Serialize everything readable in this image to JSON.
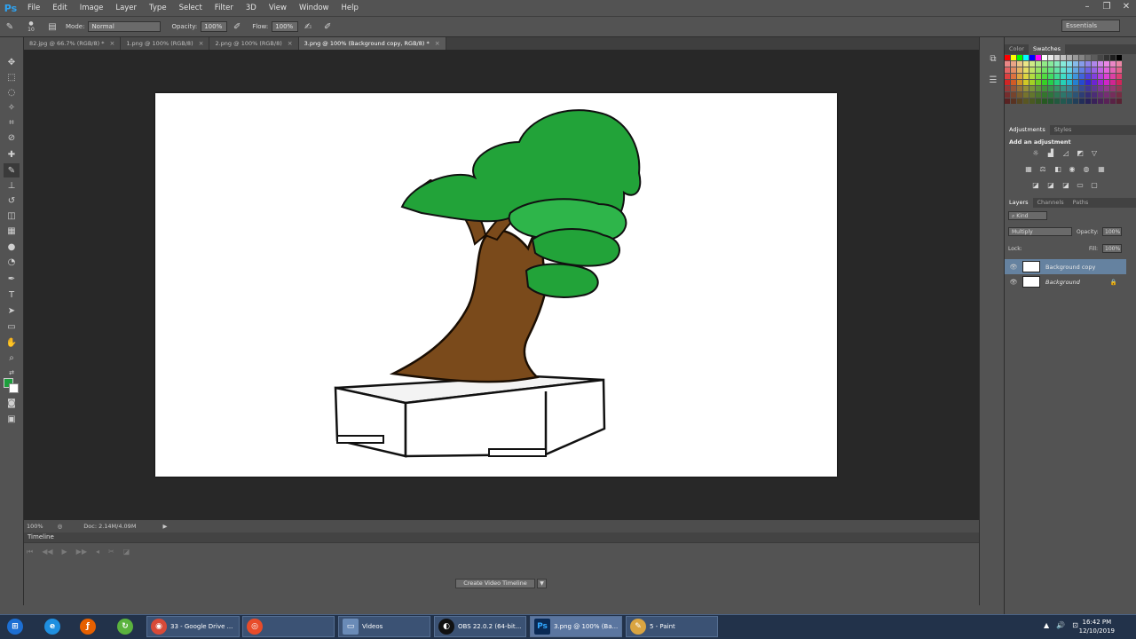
{
  "app": {
    "logo": "Ps",
    "menu": [
      "File",
      "Edit",
      "Image",
      "Layer",
      "Type",
      "Select",
      "Filter",
      "3D",
      "View",
      "Window",
      "Help"
    ],
    "window_controls": [
      "–",
      "❐",
      "✕"
    ]
  },
  "options_bar": {
    "brush_size": "10",
    "mode_label": "Mode:",
    "mode_value": "Normal",
    "opacity_label": "Opacity:",
    "opacity_value": "100%",
    "flow_label": "Flow:",
    "flow_value": "100%",
    "workspace": "Essentials"
  },
  "tabs": [
    {
      "label": "82.jpg @ 66.7% (RGB/8) *",
      "active": false
    },
    {
      "label": "1.png @ 100% (RGB/8)",
      "active": false
    },
    {
      "label": "2.png @ 100% (RGB/8)",
      "active": false
    },
    {
      "label": "3.png @ 100% (Background copy, RGB/8) *",
      "active": true
    }
  ],
  "status": {
    "zoom": "100%",
    "doc_size": "Doc: 2.14M/4.09M"
  },
  "timeline": {
    "title": "Timeline",
    "create_button": "Create Video Timeline"
  },
  "panels": {
    "color_tabs": [
      "Color",
      "Swatches"
    ],
    "adjustments_tabs": [
      "Adjustments",
      "Styles"
    ],
    "adjustments_title": "Add an adjustment",
    "layers_tabs": [
      "Layers",
      "Channels",
      "Paths"
    ],
    "filter_kind": "Kind",
    "blend_mode": "Multiply",
    "opacity_label": "Opacity:",
    "opacity_value": "100%",
    "lock_label": "Lock:",
    "fill_label": "Fill:",
    "fill_value": "100%",
    "layers": [
      {
        "name": "Background copy",
        "selected": true
      },
      {
        "name": "Background",
        "selected": false
      }
    ]
  },
  "taskbar": {
    "items": [
      {
        "label": "",
        "icon": "windows-start-icon"
      },
      {
        "label": "",
        "icon": "internet-explorer-icon"
      },
      {
        "label": "",
        "icon": "firefox-icon"
      },
      {
        "label": "",
        "icon": "refresh-app-icon"
      },
      {
        "label": "33 - Google Drive ...",
        "icon": "chrome-icon"
      },
      {
        "label": "",
        "icon": "app-icon"
      },
      {
        "label": "Videos",
        "icon": "folder-icon"
      },
      {
        "label": "OBS 22.0.2 (64-bit...",
        "icon": "obs-icon"
      },
      {
        "label": "3.png @ 100% (Ba...",
        "icon": "photoshop-icon"
      },
      {
        "label": "5 - Paint",
        "icon": "paint-icon"
      }
    ],
    "time": "16:42 PM",
    "date": "12/10/2019"
  },
  "colors": {
    "foreground": "#1d9e3c",
    "background": "#ffffff"
  }
}
